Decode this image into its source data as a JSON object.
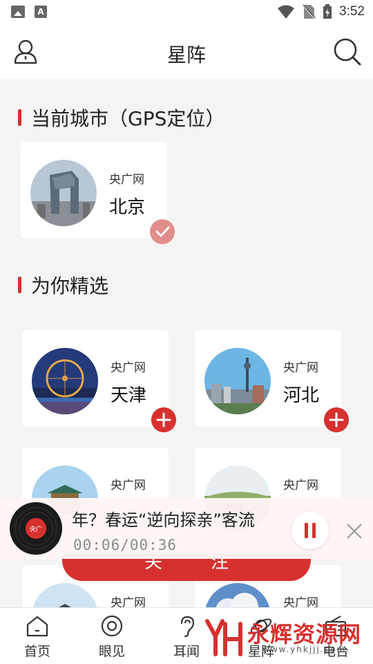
{
  "status_bar": {
    "time": "3:52"
  },
  "header": {
    "title": "星阵"
  },
  "sections": {
    "current": {
      "title": "当前城市（GPS定位）"
    },
    "picks": {
      "title": "为你精选"
    }
  },
  "current_city": {
    "source": "央广网",
    "city": "北京",
    "state": "selected"
  },
  "picks": [
    {
      "source": "央广网",
      "city": "天津"
    },
    {
      "source": "央广网",
      "city": "河北"
    },
    {
      "source": "央广网",
      "city": ""
    },
    {
      "source": "央广网",
      "city": ""
    },
    {
      "source": "央广网",
      "city": ""
    },
    {
      "source": "央广网",
      "city": ""
    }
  ],
  "player": {
    "title": "年？春运“逆向探亲”客流",
    "time": "00:06/00:36"
  },
  "follow_button": {
    "label": "关注"
  },
  "tabs": [
    {
      "label": "首页"
    },
    {
      "label": "眼见"
    },
    {
      "label": "耳闻"
    },
    {
      "label": "星阵"
    },
    {
      "label": "电台"
    }
  ],
  "watermark": {
    "logo": "YH",
    "text": "永辉资源网",
    "url": "www.yhkjjj.com"
  },
  "colors": {
    "accent": "#d6312f",
    "check_badge": "#e08e8b"
  }
}
